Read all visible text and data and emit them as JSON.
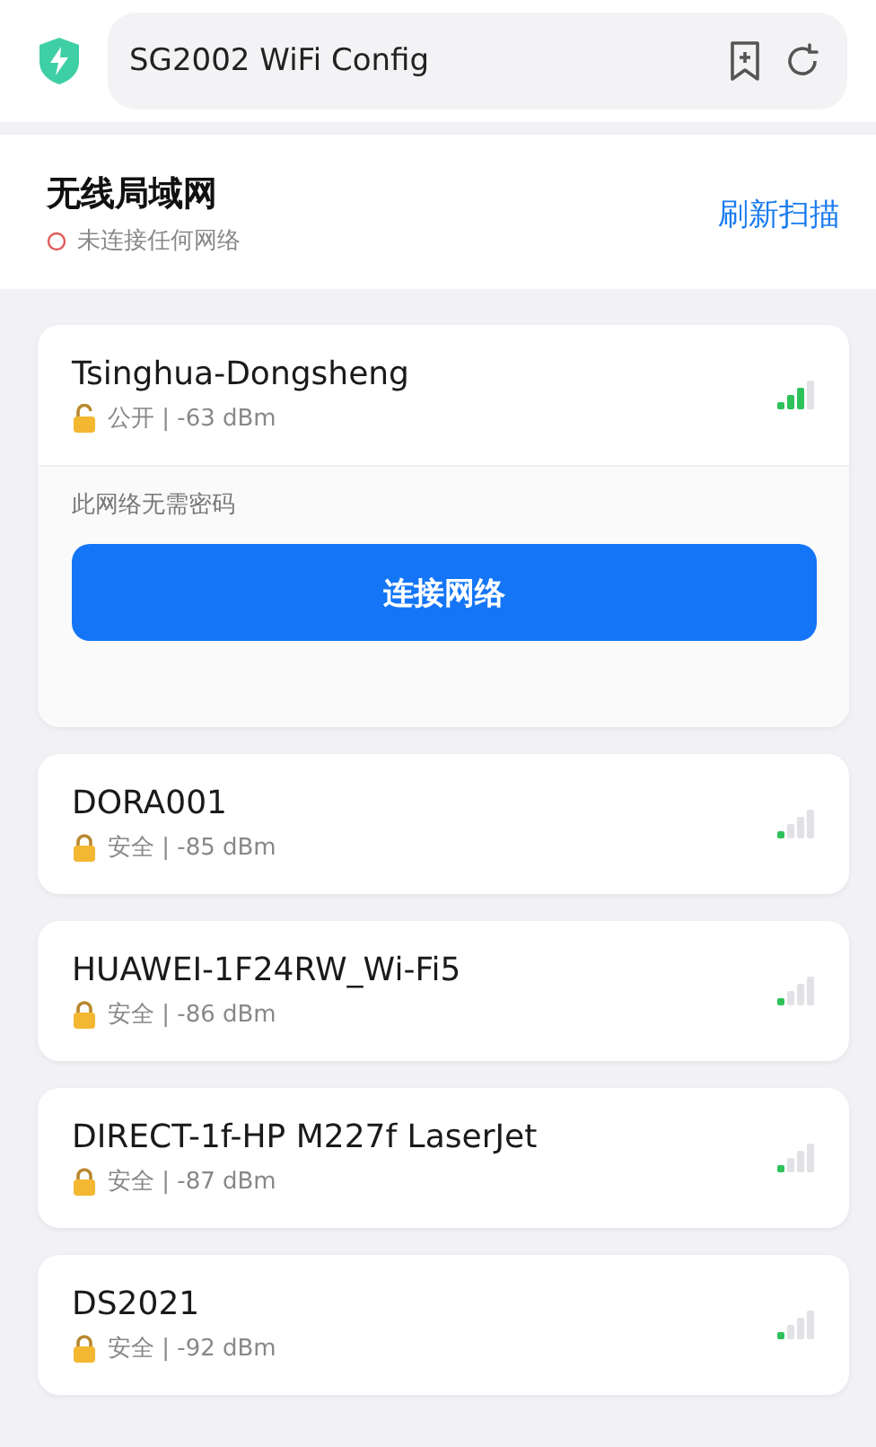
{
  "browser_bar": {
    "title": "SG2002 WiFi Config"
  },
  "header": {
    "title": "无线局域网",
    "status": "未连接任何网络",
    "refresh": "刷新扫描"
  },
  "networks": [
    {
      "name": "Tsinghua-Dongsheng",
      "secured": false,
      "detail": "公开 | -63 dBm",
      "weak_signal": false,
      "expanded": true,
      "note": "此网络无需密码",
      "connect": "连接网络"
    },
    {
      "name": "DORA001",
      "secured": true,
      "detail": "安全 | -85 dBm",
      "weak_signal": true,
      "expanded": false
    },
    {
      "name": "HUAWEI-1F24RW_Wi-Fi5",
      "secured": true,
      "detail": "安全 | -86 dBm",
      "weak_signal": true,
      "expanded": false
    },
    {
      "name": "DIRECT-1f-HP M227f LaserJet",
      "secured": true,
      "detail": "安全 | -87 dBm",
      "weak_signal": true,
      "expanded": false
    },
    {
      "name": "DS2021",
      "secured": true,
      "detail": "安全 | -92 dBm",
      "weak_signal": true,
      "expanded": false
    }
  ]
}
